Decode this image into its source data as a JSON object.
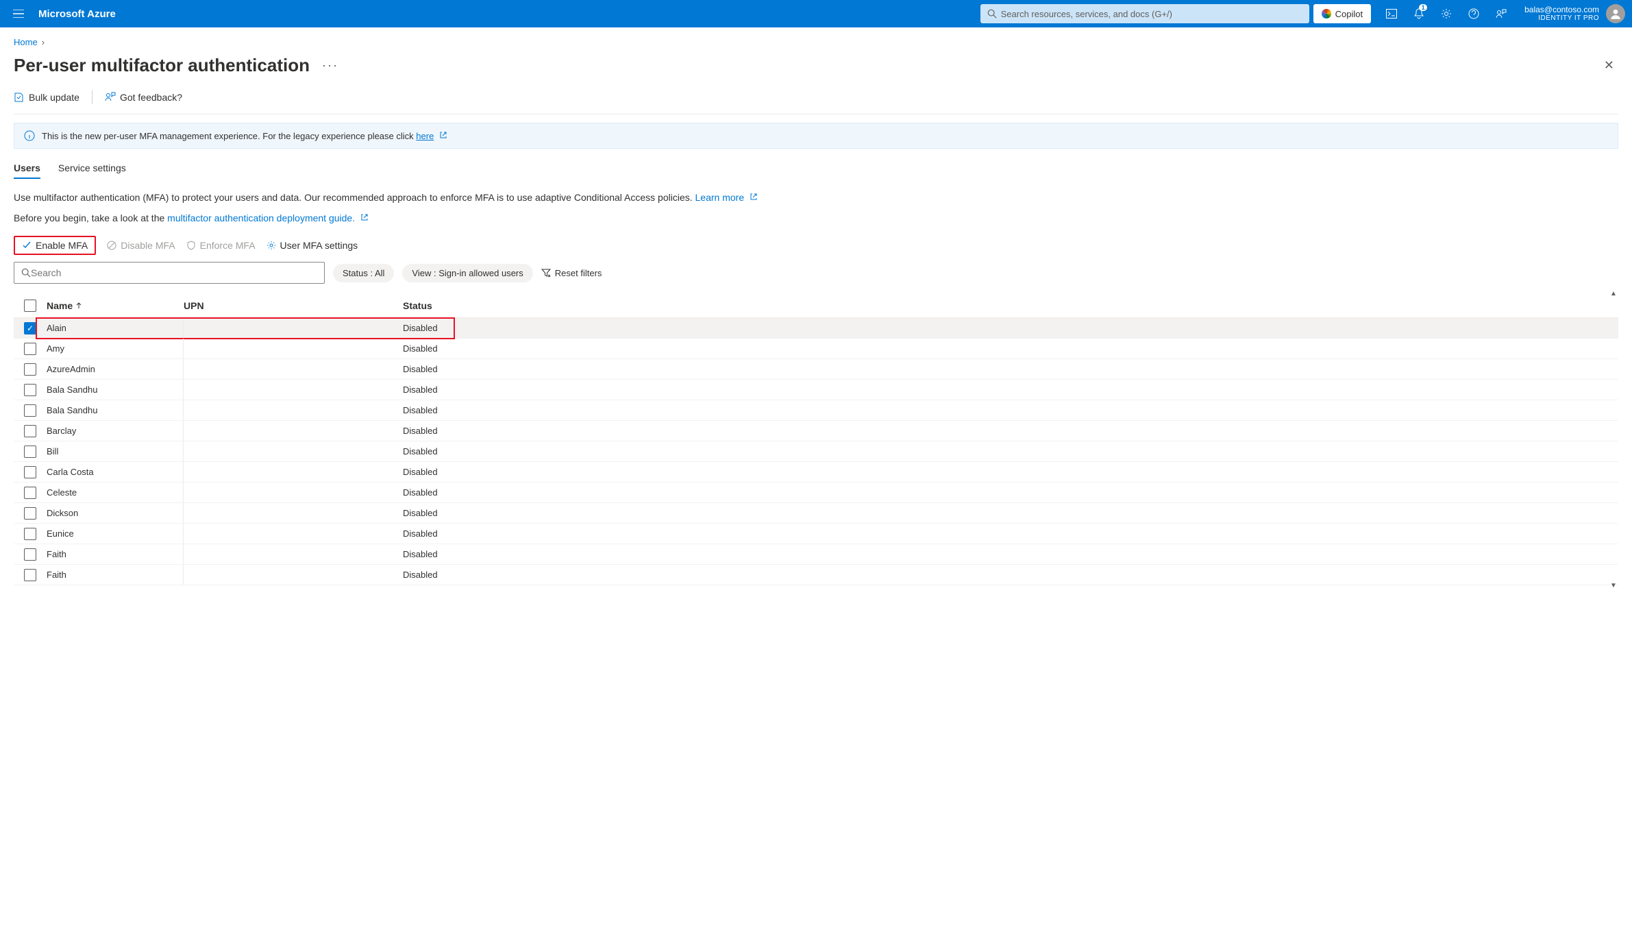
{
  "header": {
    "brand": "Microsoft Azure",
    "search_placeholder": "Search resources, services, and docs (G+/)",
    "copilot": "Copilot",
    "user_email": "balas@contoso.com",
    "user_sub": "IDENTITY IT PRO",
    "notif_count": "1"
  },
  "breadcrumb": {
    "home": "Home"
  },
  "page": {
    "title": "Per-user multifactor authentication"
  },
  "toolbar": {
    "bulk_update": "Bulk update",
    "feedback": "Got feedback?"
  },
  "banner": {
    "text_before": "This is the new per-user MFA management experience. For the legacy experience please click ",
    "link": "here"
  },
  "tabs": {
    "users": "Users",
    "service_settings": "Service settings"
  },
  "intro": {
    "line1": "Use multifactor authentication (MFA) to protect your users and data. Our recommended approach to enforce MFA is to use adaptive Conditional Access policies. ",
    "learn_more": "Learn more",
    "line2_before": "Before you begin, take a look at the ",
    "line2_link": "multifactor authentication deployment guide."
  },
  "actions": {
    "enable": "Enable MFA",
    "disable": "Disable MFA",
    "enforce": "Enforce MFA",
    "settings": "User MFA settings"
  },
  "filters": {
    "search_placeholder": "Search",
    "status_pill": "Status : All",
    "view_pill": "View : Sign-in allowed users",
    "reset": "Reset filters"
  },
  "table": {
    "col_name": "Name",
    "col_upn": "UPN",
    "col_status": "Status",
    "rows": [
      {
        "name": "Alain",
        "upn": "",
        "status": "Disabled",
        "checked": true,
        "highlight": true
      },
      {
        "name": "Amy",
        "upn": "",
        "status": "Disabled",
        "checked": false
      },
      {
        "name": "AzureAdmin",
        "upn": "",
        "status": "Disabled",
        "checked": false
      },
      {
        "name": "Bala Sandhu",
        "upn": "",
        "status": "Disabled",
        "checked": false
      },
      {
        "name": "Bala Sandhu",
        "upn": "",
        "status": "Disabled",
        "checked": false
      },
      {
        "name": "Barclay",
        "upn": "",
        "status": "Disabled",
        "checked": false
      },
      {
        "name": "Bill",
        "upn": "",
        "status": "Disabled",
        "checked": false
      },
      {
        "name": "Carla Costa",
        "upn": "",
        "status": "Disabled",
        "checked": false
      },
      {
        "name": "Celeste",
        "upn": "",
        "status": "Disabled",
        "checked": false
      },
      {
        "name": "Dickson",
        "upn": "",
        "status": "Disabled",
        "checked": false
      },
      {
        "name": "Eunice",
        "upn": "",
        "status": "Disabled",
        "checked": false
      },
      {
        "name": "Faith",
        "upn": "",
        "status": "Disabled",
        "checked": false
      },
      {
        "name": "Faith",
        "upn": "",
        "status": "Disabled",
        "checked": false
      }
    ]
  }
}
